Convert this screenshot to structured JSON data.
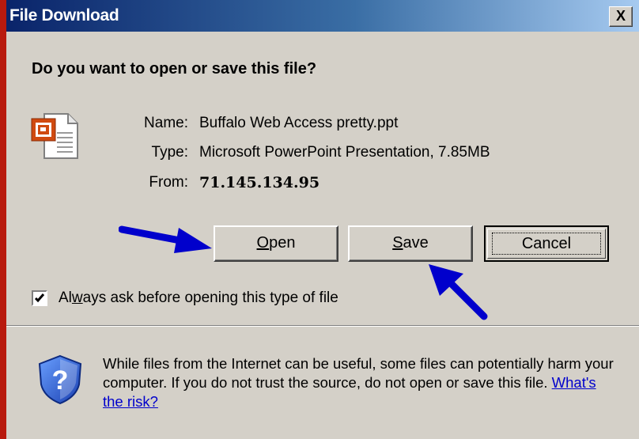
{
  "window": {
    "title": "File Download",
    "close_label": "X"
  },
  "question": "Do you want to open or save this file?",
  "file": {
    "icon": "powerpoint-file-icon",
    "name_label": "Name:",
    "name_value": "Buffalo Web Access pretty.ppt",
    "type_label": "Type:",
    "type_value": "Microsoft PowerPoint Presentation, 7.85MB",
    "from_label": "From:",
    "from_value": "71.145.134.95"
  },
  "buttons": {
    "open_acc": "O",
    "open_rest": "pen",
    "save_acc": "S",
    "save_rest": "ave",
    "cancel": "Cancel"
  },
  "checkbox": {
    "checked": true,
    "label_pre": "Al",
    "label_acc": "w",
    "label_post": "ays ask before opening this type of file"
  },
  "warning": {
    "text": "While files from the Internet can be useful, some files can potentially harm your computer. If you do not trust the source, do not open or save this file.",
    "link": "What's the risk?"
  },
  "colors": {
    "titlebar_start": "#0a246a",
    "titlebar_end": "#a6caf0",
    "dialog_bg": "#d4d0c8",
    "outer_bg": "#b81a0e",
    "annotation_arrow": "#0000cc",
    "link": "#0000cc"
  }
}
